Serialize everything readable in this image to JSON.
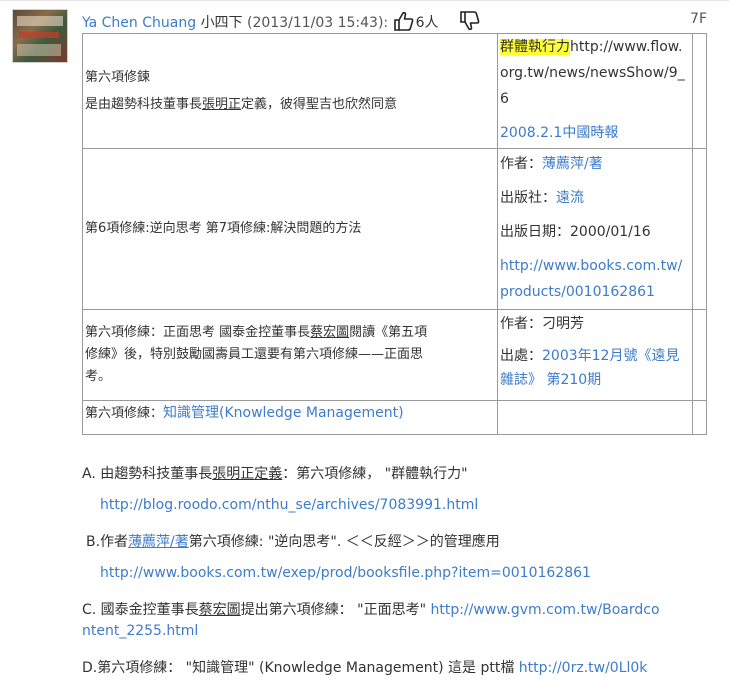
{
  "post": {
    "author": "Ya Chen Chuang",
    "rank": "小四下",
    "datetime": "(2013/11/03 15:43):",
    "like_count": "6人",
    "floor": "7F",
    "icons": {
      "like": "thumbs-up-icon",
      "dislike": "thumbs-down-icon"
    }
  },
  "table": {
    "rows": [
      {
        "left_line1": "第六項修鍊",
        "left_line2_pre": "是由趨勢科技董事長",
        "left_line2_name": "張明正",
        "left_line2_post": "定義，彼得聖吉也欣然同意",
        "right_hl": "群體執行力",
        "right_url1": "http://www.flow.",
        "right_url2": "org.tw/news/newsShow/9_",
        "right_url3": "6",
        "right_source": "2008.2.1中國時報"
      },
      {
        "left": "第6項修練:逆向思考 第7項修練:解決問題的方法",
        "author_label": "作者：",
        "author_value": "薄薦萍/著",
        "publisher_label": "出版社：",
        "publisher_value": "遠流",
        "pubdate": "出版日期：2000/01/16",
        "url1": "http://www.books.com.tw/",
        "url2": "products/0010162861"
      },
      {
        "left_line1_pre": "第六項修練：正面思考 國泰金控董事長",
        "left_line1_name": "蔡宏圖",
        "left_line1_post": "閱讀《第五項",
        "left_line2": "修練》後，特別鼓勵國壽員工還要有第六項修練——正面思",
        "left_line3": "考。",
        "author": "作者：刁明芳",
        "source_label": "出處：",
        "source_value1": "2003年12月號《遠見",
        "source_value2": "雜誌》 第210期"
      },
      {
        "left_pre": "第六項修練：",
        "left_link": "知識管理(Knowledge Management)"
      }
    ]
  },
  "lines": {
    "a_pre": "A. 由趨勢科技董事長",
    "a_name": "張明正",
    "a_mid": "定義",
    "a_post": "：第六項修練，  \"群體執行力\"",
    "a_url": "http://blog.roodo.com/nthu_se/archives/7083991.html",
    "b_pre": "B.作者",
    "b_name": "薄薦萍/著",
    "b_post": "第六項修練: \"逆向思考\". ＜＜反經＞＞的管理應用",
    "b_url": "http://www.books.com.tw/exep/prod/booksfile.php?item=0010162861",
    "c_pre": "C. 國泰金控董事長",
    "c_name": "蔡宏圖",
    "c_post": "提出第六項修練：  \"正面思考\" ",
    "c_url1": "http://www.gvm.com.tw/Boardco",
    "c_url2": "ntent_2255.html",
    "d_text": "D.第六項修練：  \"知識管理\" (Knowledge Management) 這是 ptt檔 ",
    "d_url": "http://0rz.tw/0Ll0k"
  }
}
